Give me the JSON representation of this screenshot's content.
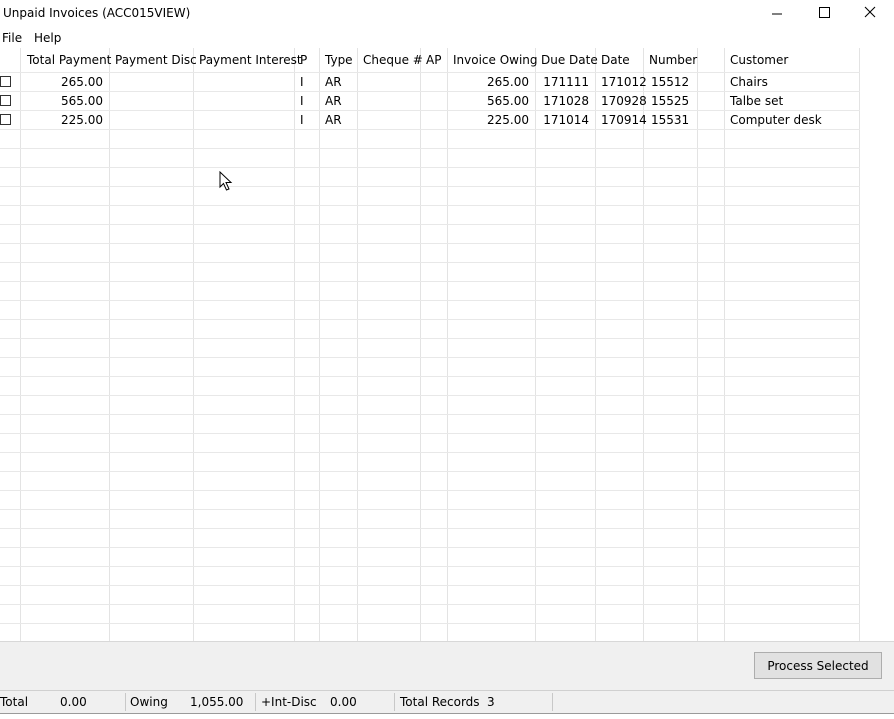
{
  "window": {
    "title": "Unpaid Invoices (ACC015VIEW)",
    "controls": [
      "minimize-icon",
      "maximize-icon",
      "close-icon"
    ]
  },
  "menu": {
    "file": "File",
    "help": "Help"
  },
  "table": {
    "headers": {
      "total_payment": "Total Payment",
      "payment_disc": "Payment Disc",
      "payment_interest": "Payment Interest",
      "p": "P",
      "type": "Type",
      "cheque": "Cheque #",
      "ap": "AP",
      "invoice_owing": "Invoice Owing",
      "due_date": "Due Date",
      "date": "Date",
      "number": "Number",
      "customer": "Customer"
    },
    "rows": [
      {
        "selected": false,
        "total_payment": "265.00",
        "payment_disc": "",
        "payment_interest": "",
        "p": "I",
        "type": "AR",
        "cheque": "",
        "ap": "",
        "invoice_owing": "265.00",
        "due_date": "171111",
        "date": "171012",
        "number": "15512",
        "customer": "Chairs"
      },
      {
        "selected": false,
        "total_payment": "565.00",
        "payment_disc": "",
        "payment_interest": "",
        "p": "I",
        "type": "AR",
        "cheque": "",
        "ap": "",
        "invoice_owing": "565.00",
        "due_date": "171028",
        "date": "170928",
        "number": "15525",
        "customer": "Talbe set"
      },
      {
        "selected": false,
        "total_payment": "225.00",
        "payment_disc": "",
        "payment_interest": "",
        "p": "I",
        "type": "AR",
        "cheque": "",
        "ap": "",
        "invoice_owing": "225.00",
        "due_date": "171014",
        "date": "170914",
        "number": "15531",
        "customer": "Computer desk"
      }
    ]
  },
  "actions": {
    "process_selected": "Process Selected"
  },
  "status": {
    "total_label": "Total",
    "total_value": "0.00",
    "owing_label": "Owing",
    "owing_value": "1,055.00",
    "intdisc_label": "+Int-Disc",
    "intdisc_value": "0.00",
    "records_label": "Total Records",
    "records_value": "3"
  },
  "colors": {
    "grid_line": "#e3e3e3",
    "panel_bg": "#f0f0f0",
    "button_bg": "#e1e1e1",
    "button_border": "#adadad"
  }
}
